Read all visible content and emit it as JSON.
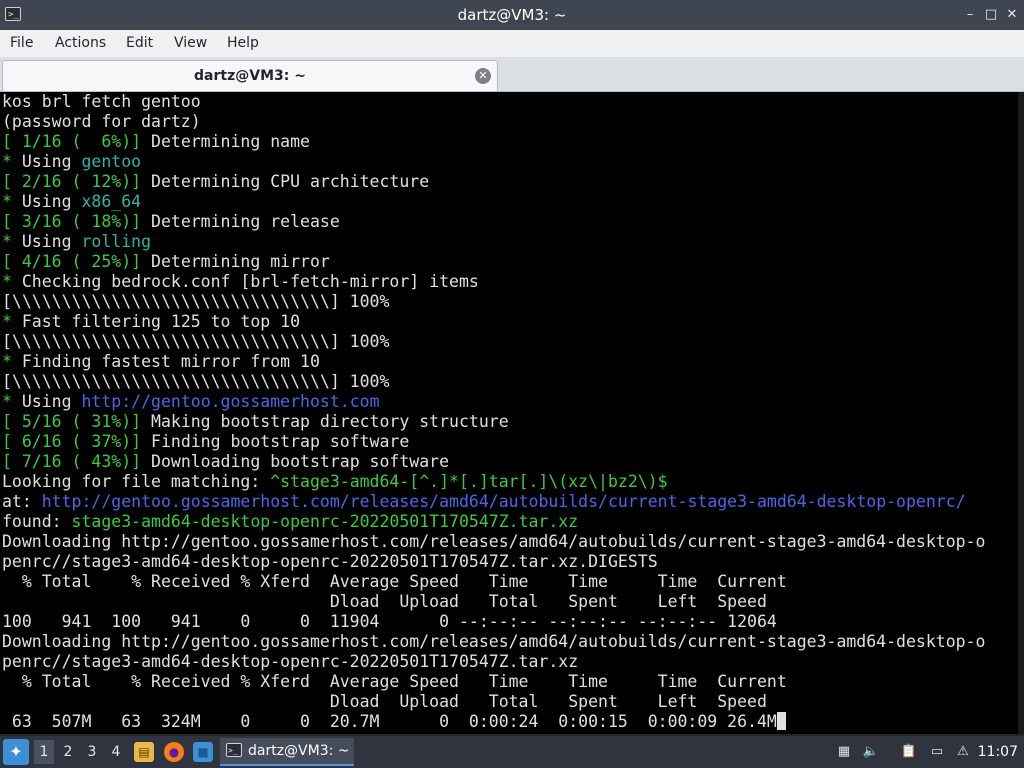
{
  "window": {
    "title": "dartz@VM3: ~",
    "app_icon_glyph": ">_",
    "minimize_glyph": "–",
    "maximize_glyph": "□",
    "close_glyph": "✕"
  },
  "menu": {
    "file": "File",
    "actions": "Actions",
    "edit": "Edit",
    "view": "View",
    "help": "Help"
  },
  "tab": {
    "label": "dartz@VM3: ~",
    "close_glyph": "✕"
  },
  "terminal": {
    "colors": {
      "background": "#000000",
      "text": "#e0e0e0",
      "green": "#3ec93e",
      "cyan": "#2fb4a4",
      "link": "#4b67e8"
    },
    "lines": [
      [
        {
          "t": "kos brl fetch gentoo",
          "c": "white"
        }
      ],
      [
        {
          "t": "(password for dartz)",
          "c": "white"
        }
      ],
      [
        {
          "t": "[ 1/16 (  6%)]",
          "c": "green"
        },
        {
          "t": " Determining name",
          "c": "white"
        }
      ],
      [
        {
          "t": "*",
          "c": "green"
        },
        {
          "t": " Using ",
          "c": "white"
        },
        {
          "t": "gentoo",
          "c": "cyan"
        }
      ],
      [
        {
          "t": "[ 2/16 ( 12%)]",
          "c": "green"
        },
        {
          "t": " Determining CPU architecture",
          "c": "white"
        }
      ],
      [
        {
          "t": "*",
          "c": "green"
        },
        {
          "t": " Using ",
          "c": "white"
        },
        {
          "t": "x86_64",
          "c": "cyan"
        }
      ],
      [
        {
          "t": "[ 3/16 ( 18%)]",
          "c": "green"
        },
        {
          "t": " Determining release",
          "c": "white"
        }
      ],
      [
        {
          "t": "*",
          "c": "green"
        },
        {
          "t": " Using ",
          "c": "white"
        },
        {
          "t": "rolling",
          "c": "cyan"
        }
      ],
      [
        {
          "t": "[ 4/16 ( 25%)]",
          "c": "green"
        },
        {
          "t": " Determining mirror",
          "c": "white"
        }
      ],
      [
        {
          "t": "*",
          "c": "green"
        },
        {
          "t": " Checking bedrock.conf [brl-fetch-mirror] items",
          "c": "white"
        }
      ],
      [
        {
          "t": "[\\\\\\\\\\\\\\\\\\\\\\\\\\\\\\\\\\\\\\\\\\\\\\\\\\\\\\\\\\\\\\\\] 100%",
          "c": "white"
        }
      ],
      [
        {
          "t": "*",
          "c": "green"
        },
        {
          "t": " Fast filtering 125 to top 10",
          "c": "white"
        }
      ],
      [
        {
          "t": "[\\\\\\\\\\\\\\\\\\\\\\\\\\\\\\\\\\\\\\\\\\\\\\\\\\\\\\\\\\\\\\\\] 100%",
          "c": "white"
        }
      ],
      [
        {
          "t": "*",
          "c": "green"
        },
        {
          "t": " Finding fastest mirror from 10",
          "c": "white"
        }
      ],
      [
        {
          "t": "[\\\\\\\\\\\\\\\\\\\\\\\\\\\\\\\\\\\\\\\\\\\\\\\\\\\\\\\\\\\\\\\\] 100%",
          "c": "white"
        }
      ],
      [
        {
          "t": "*",
          "c": "green"
        },
        {
          "t": " Using ",
          "c": "white"
        },
        {
          "t": "http://gentoo.gossamerhost.com",
          "c": "link"
        }
      ],
      [
        {
          "t": "[ 5/16 ( 31%)]",
          "c": "green"
        },
        {
          "t": " Making bootstrap directory structure",
          "c": "white"
        }
      ],
      [
        {
          "t": "[ 6/16 ( 37%)]",
          "c": "green"
        },
        {
          "t": " Finding bootstrap software",
          "c": "white"
        }
      ],
      [
        {
          "t": "[ 7/16 ( 43%)]",
          "c": "green"
        },
        {
          "t": " Downloading bootstrap software",
          "c": "white"
        }
      ],
      [
        {
          "t": "Looking for file matching: ",
          "c": "white"
        },
        {
          "t": "^stage3-amd64-[^.]*[.]tar[.]\\(xz\\|bz2\\)$",
          "c": "green"
        }
      ],
      [
        {
          "t": "at: ",
          "c": "white"
        },
        {
          "t": "http://gentoo.gossamerhost.com/releases/amd64/autobuilds/current-stage3-amd64-desktop-openrc/",
          "c": "link"
        }
      ],
      [
        {
          "t": "found: ",
          "c": "white"
        },
        {
          "t": "stage3-amd64-desktop-openrc-20220501T170547Z.tar.xz",
          "c": "green"
        }
      ],
      [
        {
          "t": "Downloading http://gentoo.gossamerhost.com/releases/amd64/autobuilds/current-stage3-amd64-desktop-o",
          "c": "white"
        }
      ],
      [
        {
          "t": "penrc//stage3-amd64-desktop-openrc-20220501T170547Z.tar.xz.DIGESTS",
          "c": "white"
        }
      ],
      [
        {
          "t": "  % Total    % Received % Xferd  Average Speed   Time    Time     Time  Current",
          "c": "white"
        }
      ],
      [
        {
          "t": "                                 Dload  Upload   Total   Spent    Left  Speed",
          "c": "white"
        }
      ],
      [
        {
          "t": "100   941  100   941    0     0  11904      0 --:--:-- --:--:-- --:--:-- 12064",
          "c": "white"
        }
      ],
      [
        {
          "t": "Downloading http://gentoo.gossamerhost.com/releases/amd64/autobuilds/current-stage3-amd64-desktop-o",
          "c": "white"
        }
      ],
      [
        {
          "t": "penrc//stage3-amd64-desktop-openrc-20220501T170547Z.tar.xz",
          "c": "white"
        }
      ],
      [
        {
          "t": "  % Total    % Received % Xferd  Average Speed   Time    Time     Time  Current",
          "c": "white"
        }
      ],
      [
        {
          "t": "                                 Dload  Upload   Total   Spent    Left  Speed",
          "c": "white"
        }
      ],
      [
        {
          "t": " 63  507M   63  324M    0     0  20.7M      0  0:00:24  0:00:15  0:00:09 26.4M",
          "c": "white"
        }
      ]
    ]
  },
  "taskbar": {
    "start_glyph": "✦",
    "workspaces": [
      "1",
      "2",
      "3",
      "4"
    ],
    "active_workspace": "1",
    "launchers": [
      {
        "name": "file-manager-icon",
        "glyph": "▤",
        "color": "#e8b84a"
      },
      {
        "name": "firefox-icon",
        "glyph": "●",
        "color": "#ff7a18"
      },
      {
        "name": "desktop-icon",
        "glyph": "■",
        "color": "#3d8fd6"
      }
    ],
    "task": {
      "label": "dartz@VM3: ~",
      "icon_glyph": ">_"
    },
    "tray": [
      {
        "name": "keyboard-layout-icon",
        "glyph": "▦"
      },
      {
        "name": "volume-icon",
        "glyph": "🔈"
      },
      {
        "name": "clipboard-icon",
        "glyph": "📋"
      },
      {
        "name": "network-icon",
        "glyph": "▭"
      },
      {
        "name": "update-notifier-icon",
        "glyph": "⚠"
      }
    ],
    "clock": "11:07"
  }
}
